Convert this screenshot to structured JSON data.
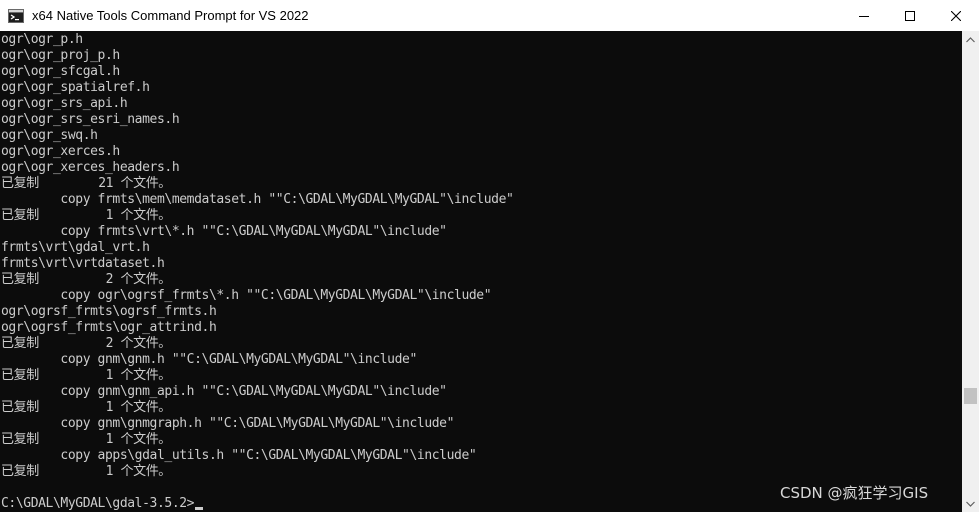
{
  "window": {
    "title": "x64 Native Tools Command Prompt for VS 2022",
    "icon": "console-icon",
    "controls": [
      "minimize-icon",
      "maximize-icon",
      "close-icon"
    ]
  },
  "console": {
    "lines": [
      "ogr\\ogr_p.h",
      "ogr\\ogr_proj_p.h",
      "ogr\\ogr_sfcgal.h",
      "ogr\\ogr_spatialref.h",
      "ogr\\ogr_srs_api.h",
      "ogr\\ogr_srs_esri_names.h",
      "ogr\\ogr_swq.h",
      "ogr\\ogr_xerces.h",
      "ogr\\ogr_xerces_headers.h",
      "已复制        21 个文件。",
      "        copy frmts\\mem\\memdataset.h \"\"C:\\GDAL\\MyGDAL\\MyGDAL\"\\include\"",
      "已复制         1 个文件。",
      "        copy frmts\\vrt\\*.h \"\"C:\\GDAL\\MyGDAL\\MyGDAL\"\\include\"",
      "frmts\\vrt\\gdal_vrt.h",
      "frmts\\vrt\\vrtdataset.h",
      "已复制         2 个文件。",
      "        copy ogr\\ogrsf_frmts\\*.h \"\"C:\\GDAL\\MyGDAL\\MyGDAL\"\\include\"",
      "ogr\\ogrsf_frmts\\ogrsf_frmts.h",
      "ogr\\ogrsf_frmts\\ogr_attrind.h",
      "已复制         2 个文件。",
      "        copy gnm\\gnm.h \"\"C:\\GDAL\\MyGDAL\\MyGDAL\"\\include\"",
      "已复制         1 个文件。",
      "        copy gnm\\gnm_api.h \"\"C:\\GDAL\\MyGDAL\\MyGDAL\"\\include\"",
      "已复制         1 个文件。",
      "        copy gnm\\gnmgraph.h \"\"C:\\GDAL\\MyGDAL\\MyGDAL\"\\include\"",
      "已复制         1 个文件。",
      "        copy apps\\gdal_utils.h \"\"C:\\GDAL\\MyGDAL\\MyGDAL\"\\include\"",
      "已复制         1 个文件。",
      ""
    ],
    "prompt": "C:\\GDAL\\MyGDAL\\gdal-3.5.2>"
  },
  "watermark": "CSDN @疯狂学习GIS",
  "colors": {
    "console_bg": "#0c0c0c",
    "console_fg": "#cccccc",
    "titlebar_bg": "#ffffff",
    "scrollbar_bg": "#f0f0f0"
  }
}
